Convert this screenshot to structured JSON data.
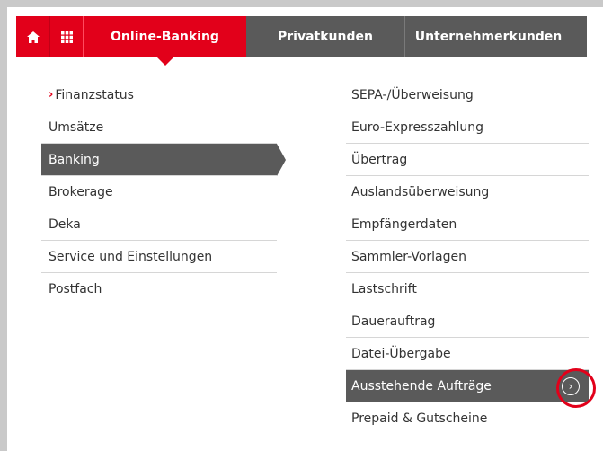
{
  "topnav": {
    "online_banking": "Online-Banking",
    "privatkunden": "Privatkunden",
    "unternehmerkunden": "Unternehmerkunden"
  },
  "left_menu": [
    {
      "label": "Finanzstatus",
      "marker": "›"
    },
    {
      "label": "Umsätze"
    },
    {
      "label": "Banking"
    },
    {
      "label": "Brokerage"
    },
    {
      "label": "Deka"
    },
    {
      "label": "Service und Einstellungen"
    },
    {
      "label": "Postfach"
    }
  ],
  "right_menu": [
    {
      "label": "SEPA-/Überweisung"
    },
    {
      "label": "Euro-Expresszahlung"
    },
    {
      "label": "Übertrag"
    },
    {
      "label": "Auslandsüberweisung"
    },
    {
      "label": "Empfängerdaten"
    },
    {
      "label": "Sammler-Vorlagen"
    },
    {
      "label": "Lastschrift"
    },
    {
      "label": "Dauerauftrag"
    },
    {
      "label": "Datei-Übergabe"
    },
    {
      "label": "Ausstehende Aufträge"
    },
    {
      "label": "Prepaid & Gutscheine"
    }
  ],
  "colors": {
    "brand_red": "#e2001a",
    "nav_gray": "#5a5a5a",
    "page_bg": "#c9c9c9"
  },
  "icons": {
    "home": "home-icon",
    "grid": "grid-icon",
    "arrow": "circle-arrow-right-icon"
  }
}
